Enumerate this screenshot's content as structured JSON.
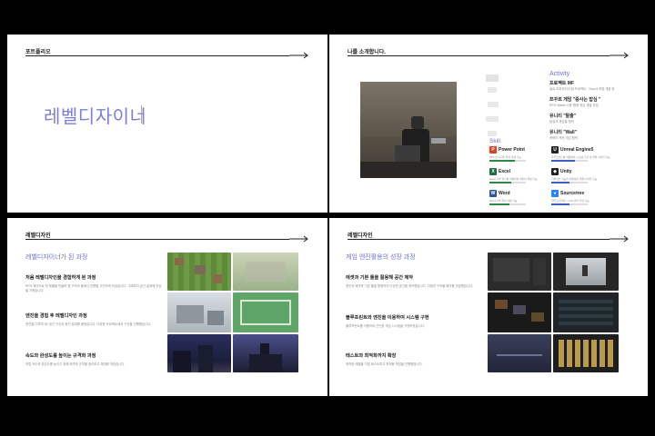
{
  "slides": {
    "s1": {
      "header": "포트폴리오",
      "main_title": "레벨디자이너"
    },
    "s2": {
      "header": "나를 소개합니다.",
      "activity_title": "Activity",
      "activities": [
        {
          "title": "프로젝트 MF",
          "desc": "솔로 리포지터리 팀 프로젝트 · Sound 작업 개발 등"
        },
        {
          "title": "쯔꾸르 게임 \"중사는 밥심 \"",
          "desc": "RPG Maker 사용 활용 게임 개발 작업"
        },
        {
          "title": "유니티 \"탈출\"",
          "desc": "팀워크 게임을 협력"
        },
        {
          "title": "유니티 \"Wall\"",
          "desc": "캐릭터 액션 게임 협력"
        }
      ],
      "skill_title": "Skill",
      "skills": [
        {
          "name": "Power Point",
          "desc": "PPT 및 디자인 문서 작성 가능",
          "level": 0.7,
          "color": "#d24726",
          "glyph": "P"
        },
        {
          "name": "Unreal Engine5",
          "desc": "블루프린트를 이용하여 시스템 구현 및 레벨 디자인 가능",
          "level": 0.65,
          "color": "#222222",
          "glyph": "U"
        },
        {
          "name": "Excel",
          "desc": "Excel 기본 함수를 이용하여 데이터 작성 가능",
          "level": 0.6,
          "color": "#1d6f42",
          "glyph": "X"
        },
        {
          "name": "Unity",
          "desc": "기본적인 기능을 이용하여 레벨 디자인 가능",
          "level": 0.5,
          "color": "#222222",
          "glyph": "◆"
        },
        {
          "name": "Word",
          "desc": "Word 기본 문서 작성 가능",
          "level": 0.55,
          "color": "#2b579a",
          "glyph": "W"
        },
        {
          "name": "Sourcetree",
          "desc": "협업 프로젝트 시 Git 관리 경험 가능",
          "level": 0.5,
          "color": "#2684ff",
          "glyph": "●"
        }
      ]
    },
    "s3": {
      "header": "레벨디자인",
      "title": "레벨디자이너가 된 과정",
      "sections": [
        {
          "title": "처음 레벨디자인을 경험하게 된 과정",
          "desc": "RPG 메이커로 첫 레벨을 만들며 맵 구조와 플레이 흐름을 고민하게 되었습니다. 그때부터 공간 설계에 관심을 가졌습니다."
        },
        {
          "title": "엔진을 경험 후 레벨디자인 과정",
          "desc": "엔진을 다루며 3D 공간 구성과 동선 설계를 배웠습니다. 다양한 프로젝트에서 구성을 진행했습니다."
        },
        {
          "title": "속도와 완성도를 높이는 규격화 과정",
          "desc": "작업 속도와 완성도를 높이기 위해 에셋과 규칙을 정리하고 체계화 하였습니다."
        }
      ]
    },
    "s4": {
      "header": "레벨디자인",
      "title": "게임 엔진활용의 성장 과정",
      "sections": [
        {
          "title": "에셋과 기본 툴을 활용해 공간 제작",
          "desc": "엔진의 에셋과 기본 툴을 활용하여 다양한 공간을 제작했습니다. 지형과 구조물 배치를 연습했습니다."
        },
        {
          "title": "블루프린트와 엔진을 이용하여 시스템 구현",
          "desc": "블루프린트를 이용하여 간단한 게임 시스템을 구현하였습니다."
        },
        {
          "title": "테스트와 최적화까지 확장",
          "desc": "제작한 레벨을 직접 테스트하고 최적화 작업을 진행했습니다."
        }
      ]
    }
  }
}
